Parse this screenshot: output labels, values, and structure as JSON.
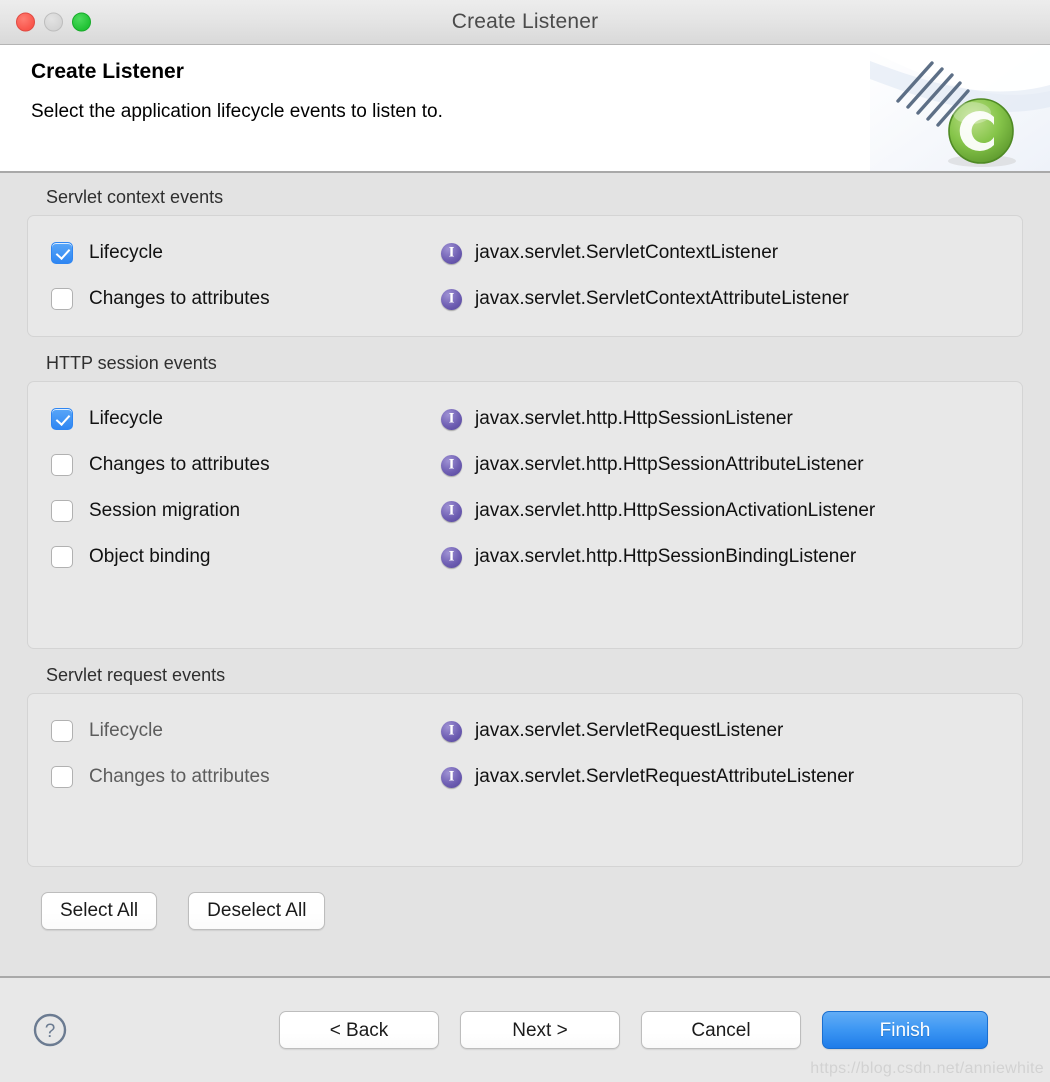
{
  "window": {
    "title": "Create Listener",
    "traffic_lights": [
      "close-button",
      "minimize-button",
      "maximize-button"
    ]
  },
  "header": {
    "title": "Create Listener",
    "subtitle": "Select the application lifecycle events to listen to.",
    "banner_icon": "green-c-sphere-banner"
  },
  "groups": [
    {
      "label": "Servlet context events",
      "rows": [
        {
          "label": "Lifecycle",
          "checked": true,
          "interface": "javax.servlet.ServletContextListener"
        },
        {
          "label": "Changes to attributes",
          "checked": false,
          "interface": "javax.servlet.ServletContextAttributeListener"
        }
      ]
    },
    {
      "label": "HTTP session events",
      "rows": [
        {
          "label": "Lifecycle",
          "checked": true,
          "interface": "javax.servlet.http.HttpSessionListener"
        },
        {
          "label": "Changes to attributes",
          "checked": false,
          "interface": "javax.servlet.http.HttpSessionAttributeListener"
        },
        {
          "label": "Session migration",
          "checked": false,
          "interface": "javax.servlet.http.HttpSessionActivationListener"
        },
        {
          "label": "Object binding",
          "checked": false,
          "interface": "javax.servlet.http.HttpSessionBindingListener"
        }
      ]
    },
    {
      "label": "Servlet request events",
      "rows": [
        {
          "label": "Lifecycle",
          "checked": false,
          "interface": "javax.servlet.ServletRequestListener"
        },
        {
          "label": "Changes to attributes",
          "checked": false,
          "interface": "javax.servlet.ServletRequestAttributeListener"
        }
      ]
    }
  ],
  "selection_buttons": {
    "select_all": "Select All",
    "deselect_all": "Deselect All"
  },
  "footer": {
    "help_icon": "help-question-icon",
    "back": "< Back",
    "next": "Next >",
    "cancel": "Cancel",
    "finish": "Finish"
  },
  "watermark": "https://blog.csdn.net/anniewhite",
  "colors": {
    "accent_blue": "#3d97f3",
    "checkbox_checked": "#2f86f2",
    "interface_icon_purple": "#6f5fb3",
    "window_background": "#e3e3e3",
    "panel_background": "#e8e8e8",
    "banner_green": "#7ac043"
  }
}
